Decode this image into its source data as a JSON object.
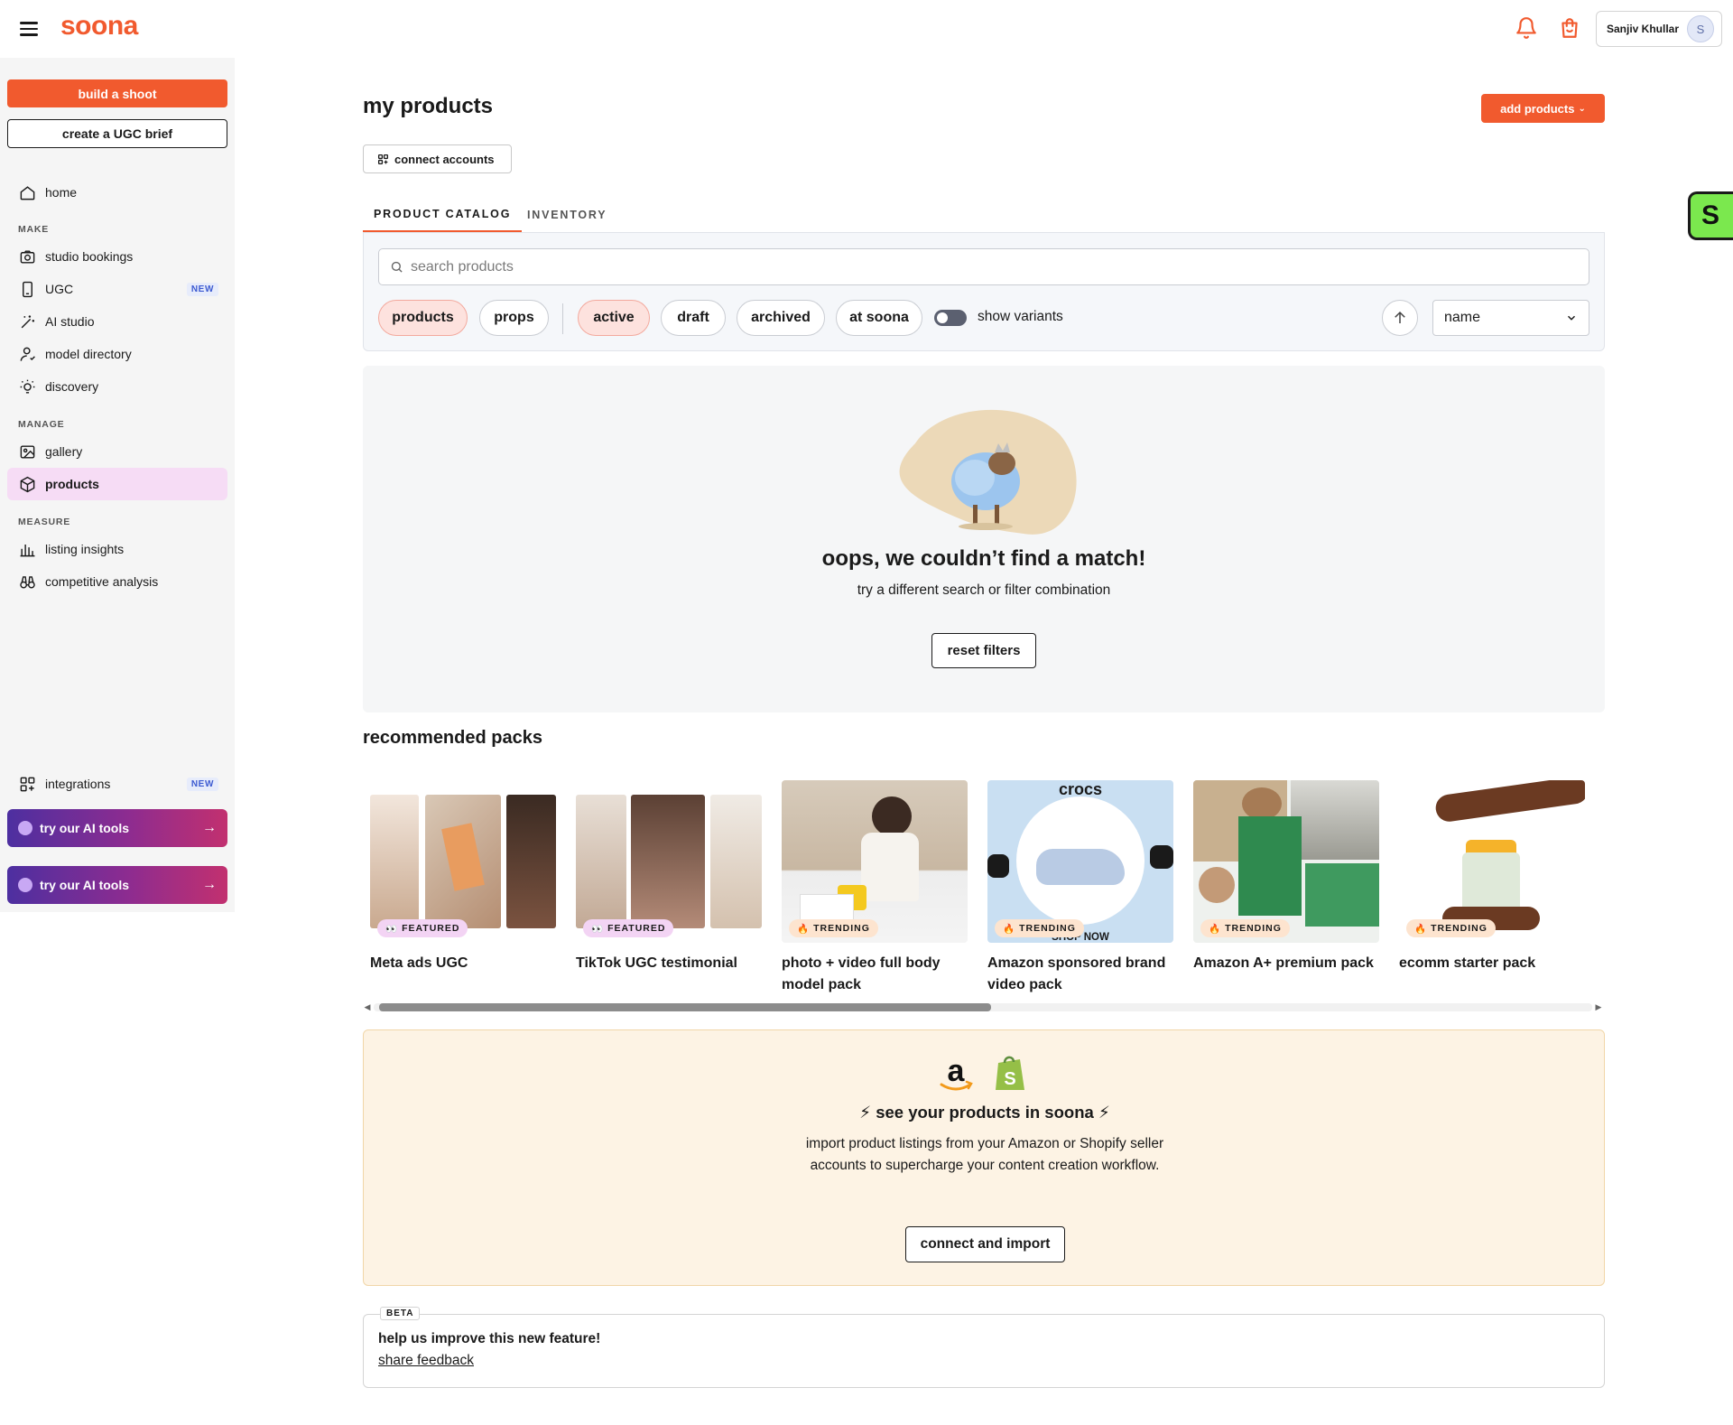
{
  "header": {
    "logo": "soona",
    "account_name": "Sanjiv Khullar",
    "avatar_initial": "S"
  },
  "sidebar": {
    "build_shoot": "build a shoot",
    "ugc_brief": "create a UGC brief",
    "home": "home",
    "section_make": "MAKE",
    "make_items": [
      {
        "label": "studio bookings",
        "icon": "camera-icon"
      },
      {
        "label": "UGC",
        "icon": "phone-icon",
        "badge": "NEW"
      },
      {
        "label": "AI studio",
        "icon": "magic-wand-icon"
      },
      {
        "label": "model directory",
        "icon": "person-icon"
      },
      {
        "label": "discovery",
        "icon": "lightbulb-icon"
      }
    ],
    "section_manage": "MANAGE",
    "manage_items": [
      {
        "label": "gallery",
        "icon": "image-icon"
      },
      {
        "label": "products",
        "icon": "box-icon",
        "active": true
      }
    ],
    "section_measure": "MEASURE",
    "measure_items": [
      {
        "label": "listing insights",
        "icon": "bar-chart-icon"
      },
      {
        "label": "competitive analysis",
        "icon": "binoculars-icon"
      }
    ],
    "integrations": {
      "label": "integrations",
      "badge": "NEW"
    },
    "ai_tools": [
      "try our AI tools",
      "try our AI tools"
    ]
  },
  "main": {
    "title": "my products",
    "add_products": "add products",
    "connect_accounts": "connect accounts",
    "tabs": [
      {
        "label": "PRODUCT CATALOG",
        "active": true
      },
      {
        "label": "INVENTORY",
        "active": false
      }
    ],
    "search_placeholder": "search products",
    "type_filters": [
      {
        "label": "products",
        "selected": true
      },
      {
        "label": "props",
        "selected": false
      }
    ],
    "status_filters": [
      {
        "label": "active",
        "selected": true
      },
      {
        "label": "draft",
        "selected": false
      },
      {
        "label": "archived",
        "selected": false
      },
      {
        "label": "at soona",
        "selected": false
      }
    ],
    "show_variants": "show variants",
    "show_variants_on": false,
    "sort_value": "name",
    "empty_title": "oops, we couldn’t find a match!",
    "empty_subtitle": "try a different search or filter combination",
    "reset_filters": "reset filters"
  },
  "recommended": {
    "title": "recommended packs",
    "packs": [
      {
        "name": "Meta ads UGC",
        "tag": "FEATURED"
      },
      {
        "name": "TikTok UGC testimonial",
        "tag": "FEATURED"
      },
      {
        "name": "photo + video full body model pack",
        "tag": "TRENDING"
      },
      {
        "name": "Amazon sponsored brand video pack",
        "tag": "TRENDING"
      },
      {
        "name": "Amazon A+ premium pack",
        "tag": "TRENDING"
      },
      {
        "name": "ecomm starter pack",
        "tag": "TRENDING"
      }
    ],
    "crocs_label": "crocs",
    "shop_now": "SHOP NOW"
  },
  "import": {
    "title": "⚡ see your products in soona ⚡",
    "description": "import product listings from your Amazon or Shopify seller accounts to supercharge your content creation workflow.",
    "button": "connect and import"
  },
  "feedback": {
    "badge": "BETA",
    "title": "help us improve this new feature!",
    "link": "share feedback"
  },
  "widget": {
    "letter": "S"
  },
  "colors": {
    "brand": "#f15a2e",
    "active_nav": "#f6dcf5",
    "import_bg": "#fdf3e4",
    "widget": "#7be84e"
  }
}
